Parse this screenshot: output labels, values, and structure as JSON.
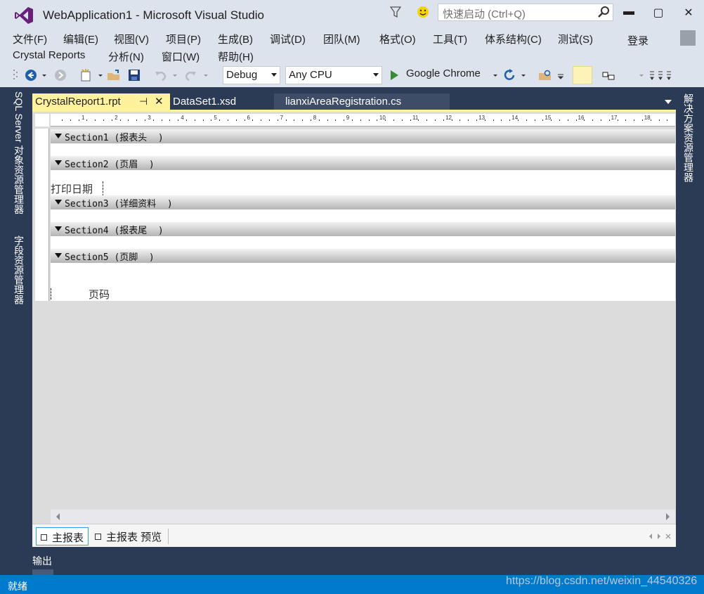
{
  "window": {
    "title": "WebApplication1 - Microsoft Visual Studio",
    "quick_launch_placeholder": "快速启动 (Ctrl+Q)",
    "min_glyph": "▬",
    "max_glyph": "▢",
    "close_glyph": "✕"
  },
  "menu": {
    "items": [
      "文件(F)",
      "编辑(E)",
      "视图(V)",
      "项目(P)",
      "生成(B)",
      "调试(D)",
      "团队(M)",
      "格式(O)",
      "工具(T)",
      "体系结构(C)",
      "测试(S)",
      "Crystal Reports",
      "分析(N)",
      "窗口(W)",
      "帮助(H)"
    ],
    "login": "登录"
  },
  "toolbar": {
    "config": "Debug",
    "platform": "Any CPU",
    "run_target": "Google Chrome"
  },
  "side_panes": {
    "left": [
      "SQL Server 对象资源管理器",
      "字段资源管理器"
    ],
    "right": [
      "解决方案资源管理器"
    ]
  },
  "tabs": {
    "active": "CrystalReport1.rpt",
    "pin_glyph": "⊣",
    "close_glyph": "✕",
    "others": [
      "DataSet1.xsd",
      "lianxiAreaRegistration.cs"
    ]
  },
  "ruler": {
    "labels": [
      "1",
      "2",
      "3",
      "4",
      "5",
      "6",
      "7",
      "8",
      "9",
      "10",
      "11",
      "12",
      "13",
      "14",
      "15",
      "16",
      "17",
      "18"
    ]
  },
  "report": {
    "sections": [
      {
        "header": "Section1 (报表头  )"
      },
      {
        "header": "Section2 (页眉  )"
      },
      {
        "header": "Section3 (详细资料  )"
      },
      {
        "header": "Section4 (报表尾  )"
      },
      {
        "header": "Section5 (页脚  )"
      }
    ],
    "print_date_field": "打印日期",
    "page_number_field": "页码"
  },
  "bottom_tabs": [
    "主报表",
    "主报表 预览"
  ],
  "output_label": "输出",
  "status_text": "就绪",
  "watermark": "https://blog.csdn.net/weixin_44540326",
  "colors": {
    "accent": "#007acc",
    "active_tab": "#fff29d",
    "chrome": "#dde3ed",
    "dark_frame": "#2b3a55"
  }
}
